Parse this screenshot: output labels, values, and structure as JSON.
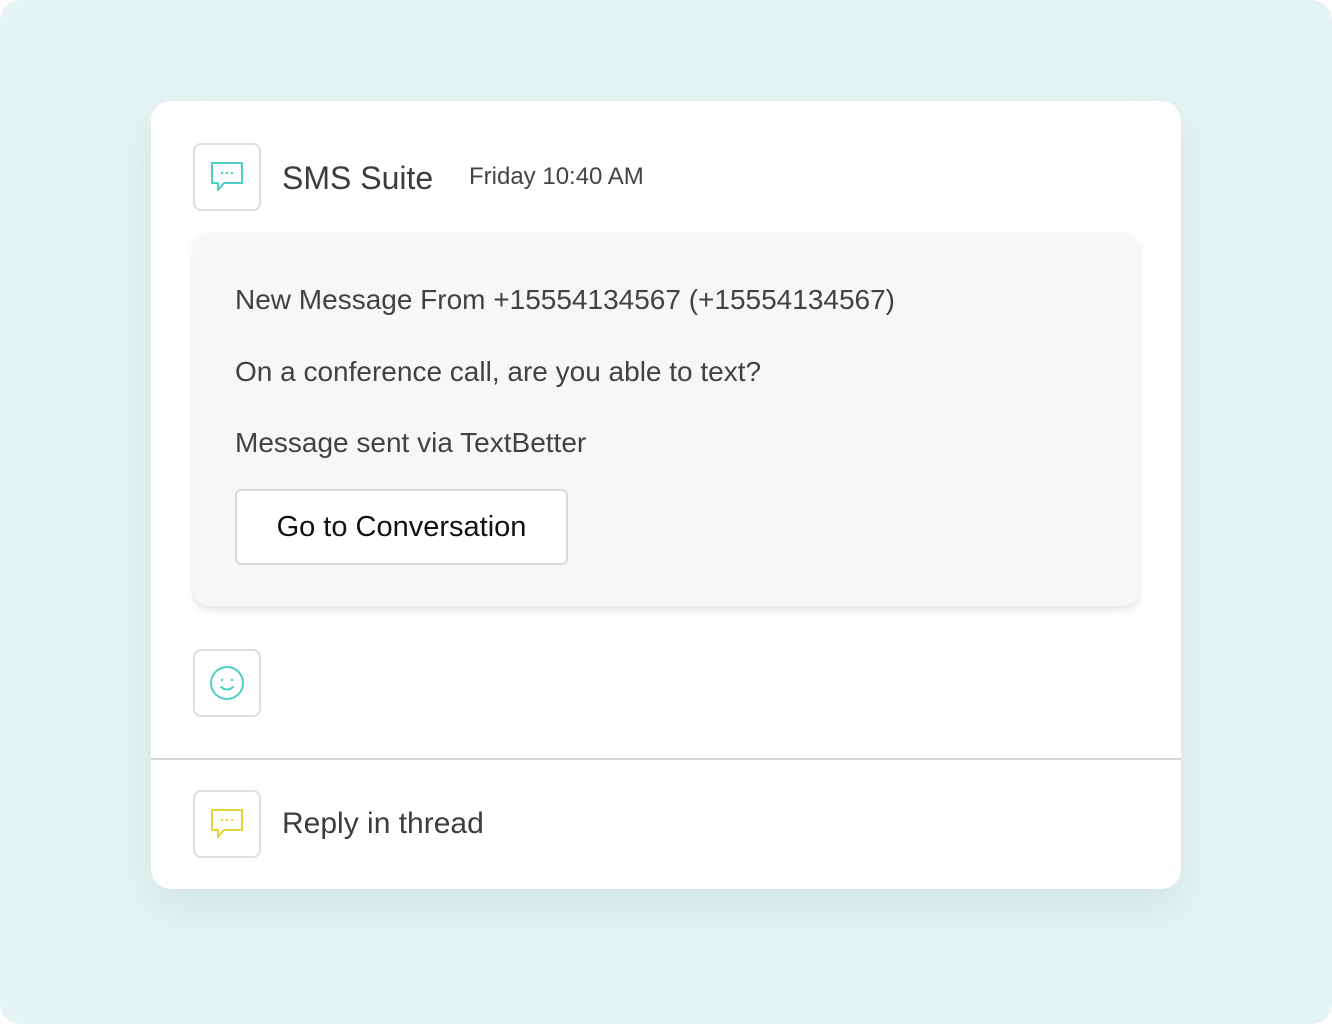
{
  "colors": {
    "background": "#e5f4f3",
    "accent_teal": "#4ccfc4",
    "accent_yellow": "#e8d535"
  },
  "header": {
    "app_icon": "chat-bubble-icon",
    "app_name": "SMS Suite",
    "timestamp": "Friday 10:40 AM"
  },
  "message": {
    "line1": "New Message From +15554134567 (+15554134567)",
    "line2": "On a conference call, are you able to text?",
    "line3": "Message sent via TextBetter",
    "button_label": "Go to Conversation"
  },
  "reaction": {
    "icon": "smiley-face-icon"
  },
  "footer": {
    "icon": "chat-bubble-icon",
    "reply_label": "Reply in thread"
  }
}
